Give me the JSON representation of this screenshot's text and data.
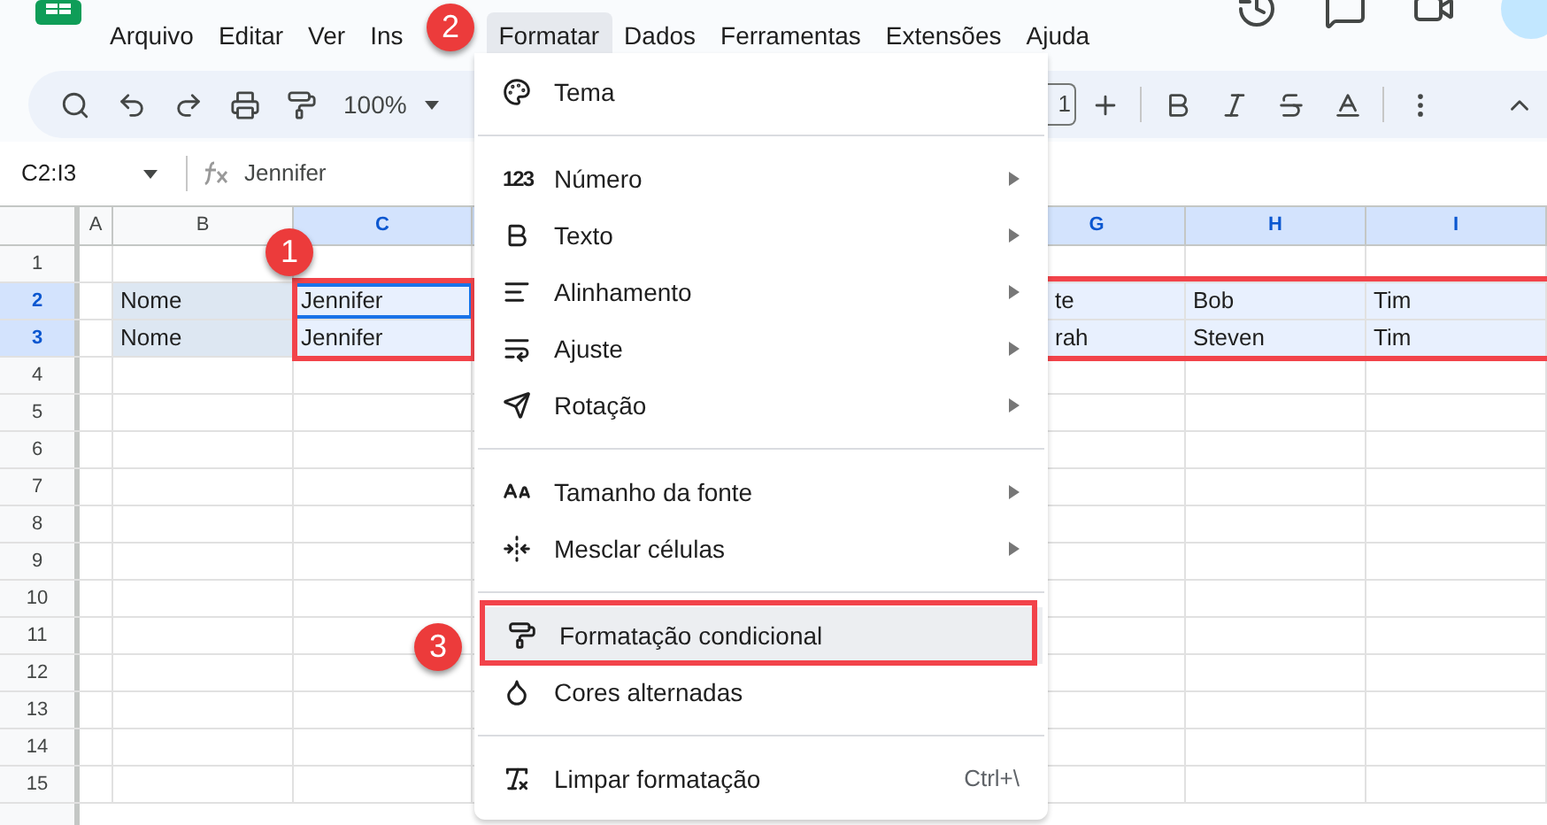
{
  "menu_bar": [
    {
      "label": "Arquivo",
      "selected": false
    },
    {
      "label": "Editar",
      "selected": false
    },
    {
      "label": "Ver",
      "selected": false
    },
    {
      "label": "Ins",
      "selected": false
    },
    {
      "label": "Formatar",
      "selected": true
    },
    {
      "label": "Dados",
      "selected": false
    },
    {
      "label": "Ferramentas",
      "selected": false
    },
    {
      "label": "Extensões",
      "selected": false
    },
    {
      "label": "Ajuda",
      "selected": false
    }
  ],
  "toolbar": {
    "zoom": "100%",
    "font_size": "1"
  },
  "formula_bar": {
    "name_box": "C2:I3",
    "value": "Jennifer"
  },
  "columns": [
    {
      "label": "A",
      "selected": false
    },
    {
      "label": "B",
      "selected": false
    },
    {
      "label": "C",
      "selected": true
    },
    {
      "label": "G",
      "selected": true
    },
    {
      "label": "H",
      "selected": true
    },
    {
      "label": "I",
      "selected": true
    }
  ],
  "rows": [
    {
      "label": "1",
      "selected": false
    },
    {
      "label": "2",
      "selected": true,
      "cells": [
        {
          "filled": false
        },
        {
          "text": "Nome",
          "filled": true
        },
        {
          "text": "Jennifer",
          "active": true
        },
        {
          "text": "te"
        },
        {
          "text": "Bob"
        },
        {
          "text": "Tim"
        }
      ]
    },
    {
      "label": "3",
      "selected": true,
      "cells": [
        {
          "filled": false
        },
        {
          "text": "Nome",
          "filled": true
        },
        {
          "text": "Jennifer",
          "active": false
        },
        {
          "text": "rah"
        },
        {
          "text": "Steven"
        },
        {
          "text": "Tim"
        }
      ]
    },
    {
      "label": "4",
      "selected": false
    },
    {
      "label": "5",
      "selected": false
    },
    {
      "label": "6",
      "selected": false
    },
    {
      "label": "7",
      "selected": false
    },
    {
      "label": "8",
      "selected": false
    },
    {
      "label": "9",
      "selected": false
    },
    {
      "label": "10",
      "selected": false
    },
    {
      "label": "11",
      "selected": false
    },
    {
      "label": "12",
      "selected": false
    },
    {
      "label": "13",
      "selected": false
    },
    {
      "label": "14",
      "selected": false
    },
    {
      "label": "15",
      "selected": false
    }
  ],
  "format_menu": [
    {
      "kind": "item",
      "label": "Tema",
      "submenu": false,
      "selected": false
    },
    {
      "kind": "separator"
    },
    {
      "kind": "item",
      "label": "Número",
      "glyph": "123",
      "submenu": true,
      "selected": false
    },
    {
      "kind": "item",
      "label": "Texto",
      "submenu": true,
      "selected": false
    },
    {
      "kind": "item",
      "label": "Alinhamento",
      "submenu": true,
      "selected": false
    },
    {
      "kind": "item",
      "label": "Ajuste",
      "submenu": true,
      "selected": false
    },
    {
      "kind": "item",
      "label": "Rotação",
      "submenu": true,
      "selected": false
    },
    {
      "kind": "separator"
    },
    {
      "kind": "item",
      "label": "Tamanho da fonte",
      "submenu": true,
      "selected": false
    },
    {
      "kind": "item",
      "label": "Mesclar células",
      "submenu": true,
      "selected": false
    },
    {
      "kind": "separator"
    },
    {
      "kind": "item",
      "label": "Formatação condicional",
      "submenu": false,
      "selected": true
    },
    {
      "kind": "item",
      "label": "Cores alternadas",
      "submenu": false,
      "selected": false
    },
    {
      "kind": "separator"
    },
    {
      "kind": "item",
      "label": "Limpar formatação",
      "submenu": false,
      "selected": false,
      "shortcut": "Ctrl+\\"
    }
  ],
  "callouts": [
    "1",
    "2",
    "3"
  ]
}
